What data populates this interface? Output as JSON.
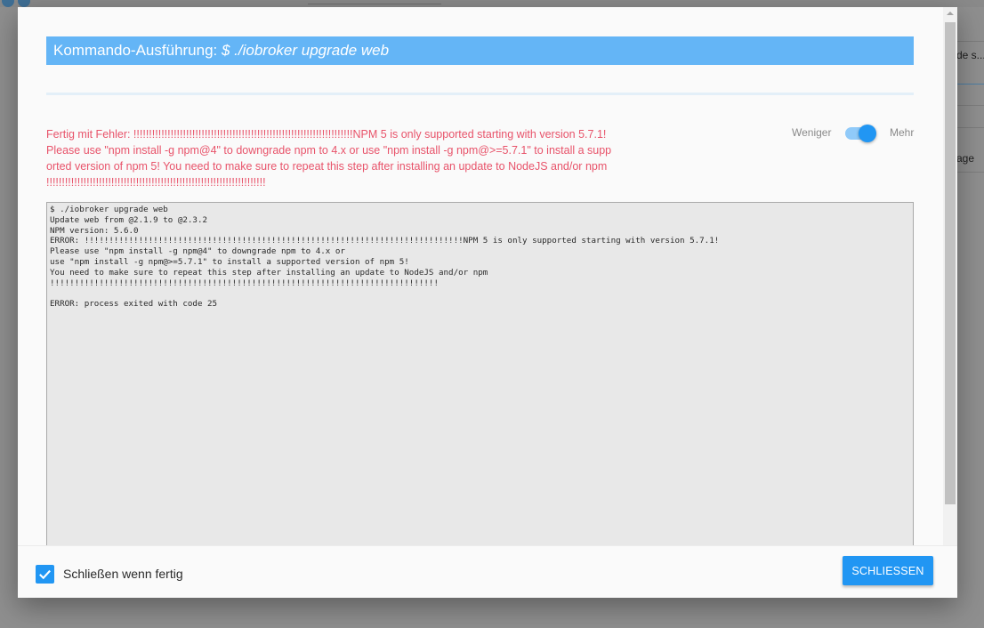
{
  "background": {
    "partial_text_1": "de s...",
    "partial_text_2": "age"
  },
  "dialog": {
    "title_prefix": "Kommando-Ausführung: ",
    "title_command": "$ ./iobroker upgrade web",
    "error_message": "Fertig mit Fehler: !!!!!!!!!!!!!!!!!!!!!!!!!!!!!!!!!!!!!!!!!!!!!!!!!!!!!!!!!!!!!!!!!!!!!!!NPM 5 is only supported starting with version 5.7.1! Please use \"npm install -g npm@4\" to downgrade npm to 4.x or use \"npm install -g npm@>=5.7.1\" to install a supported version of npm 5! You need to make sure to repeat this step after installing an update to NodeJS and/or npm !!!!!!!!!!!!!!!!!!!!!!!!!!!!!!!!!!!!!!!!!!!!!!!!!!!!!!!!!!!!!!!!!!!!!!!",
    "toggle": {
      "less_label": "Weniger",
      "more_label": "Mehr",
      "state": "Mehr"
    },
    "console_lines": [
      "$ ./iobroker upgrade web",
      "Update web from @2.1.9 to @2.3.2",
      "NPM version: 5.6.0",
      "ERROR: !!!!!!!!!!!!!!!!!!!!!!!!!!!!!!!!!!!!!!!!!!!!!!!!!!!!!!!!!!!!!!!!!!!!!!!!!!!!!NPM 5 is only supported starting with version 5.7.1!",
      "Please use \"npm install -g npm@4\" to downgrade npm to 4.x or",
      "use \"npm install -g npm@>=5.7.1\" to install a supported version of npm 5!",
      "You need to make sure to repeat this step after installing an update to NodeJS and/or npm",
      "!!!!!!!!!!!!!!!!!!!!!!!!!!!!!!!!!!!!!!!!!!!!!!!!!!!!!!!!!!!!!!!!!!!!!!!!!!!!!!!",
      "",
      "ERROR: process exited with code 25"
    ],
    "footer": {
      "checkbox_label": "Schließen wenn fertig",
      "checkbox_checked": true,
      "close_button_label": "SCHLIESSEN"
    }
  },
  "colors": {
    "title_bar": "#64b5f6",
    "error_text": "#e8536a",
    "accent": "#2196f3"
  }
}
